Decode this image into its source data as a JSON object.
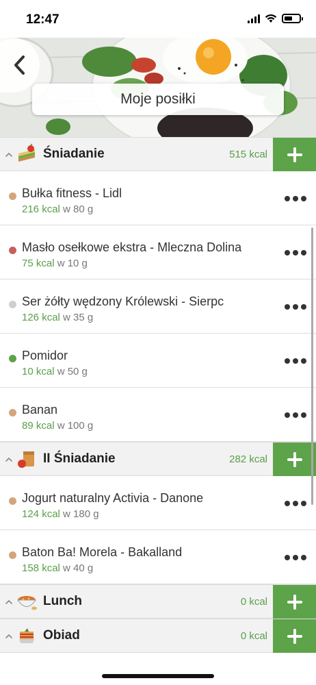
{
  "status_bar": {
    "time": "12:47"
  },
  "header": {
    "title": "Moje posiłki"
  },
  "sections": [
    {
      "title": "Śniadanie",
      "kcal": "515 kcal",
      "icon": "sandwich-icon",
      "items": [
        {
          "name": "Bułka fitness - Lidl",
          "kcal": "216 kcal",
          "amount": "w 80 g",
          "dot_color": "#d4a57c"
        },
        {
          "name": "Masło osełkowe ekstra - Mleczna Dolina",
          "kcal": "75 kcal",
          "amount": "w 10 g",
          "dot_color": "#c9605e"
        },
        {
          "name": "Ser żółty wędzony Królewski - Sierpc",
          "kcal": "126 kcal",
          "amount": "w 35 g",
          "dot_color": "#cfcfcf"
        },
        {
          "name": "Pomidor",
          "kcal": "10 kcal",
          "amount": "w 50 g",
          "dot_color": "#5da34a"
        },
        {
          "name": "Banan",
          "kcal": "89 kcal",
          "amount": "w 100 g",
          "dot_color": "#d4a57c"
        }
      ]
    },
    {
      "title": "II Śniadanie",
      "kcal": "282 kcal",
      "icon": "lunchbag-icon",
      "items": [
        {
          "name": "Jogurt naturalny Activia - Danone",
          "kcal": "124 kcal",
          "amount": "w 180 g",
          "dot_color": "#d4a57c"
        },
        {
          "name": "Baton Ba! Morela - Bakalland",
          "kcal": "158 kcal",
          "amount": "w 40 g",
          "dot_color": "#d4a57c"
        }
      ]
    },
    {
      "title": "Lunch",
      "kcal": "0 kcal",
      "icon": "soup-bowl-icon",
      "items": []
    },
    {
      "title": "Obiad",
      "kcal": "0 kcal",
      "icon": "lasagna-icon",
      "items": []
    }
  ],
  "colors": {
    "accent_green": "#5da34a",
    "kcal_green": "#5a9e48"
  }
}
